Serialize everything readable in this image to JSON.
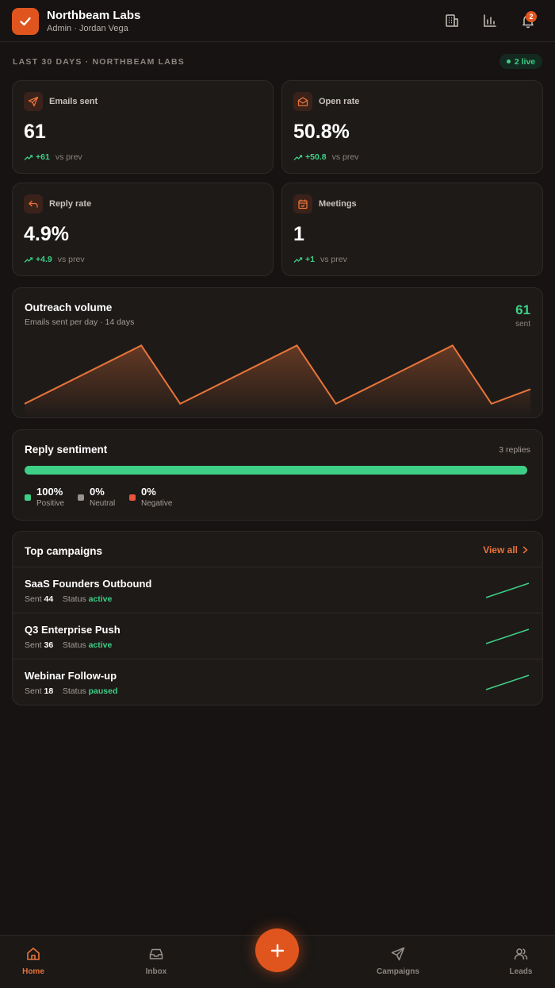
{
  "header": {
    "brand_name": "Northbeam Labs",
    "brand_sub": "Admin · Jordan Vega",
    "notification_count": "2",
    "icons": [
      "building-icon",
      "bar-chart-icon",
      "bell-icon"
    ]
  },
  "range": {
    "label": "LAST 30 DAYS · NORTHBEAM LABS",
    "live": "2 live"
  },
  "stats": [
    {
      "label": "Emails sent",
      "value": "61",
      "delta": "+61",
      "vs": "vs prev",
      "icon": "send-icon"
    },
    {
      "label": "Open rate",
      "value": "50.8%",
      "delta": "+50.8",
      "vs": "vs prev",
      "icon": "mail-open-icon"
    },
    {
      "label": "Reply rate",
      "value": "4.9%",
      "delta": "+4.9",
      "vs": "vs prev",
      "icon": "reply-icon"
    },
    {
      "label": "Meetings",
      "value": "1",
      "delta": "+1",
      "vs": "vs prev",
      "icon": "calendar-check-icon"
    }
  ],
  "volume": {
    "title": "Outreach volume",
    "subtitle": "Emails sent per day · 14 days",
    "total": "61",
    "total_unit": "sent"
  },
  "chart_data": {
    "type": "area",
    "x": [
      1,
      2,
      3,
      4,
      5,
      6,
      7,
      8,
      9,
      10,
      11,
      12,
      13,
      14
    ],
    "values": [
      1,
      3,
      5,
      7,
      1,
      3,
      5,
      7,
      1,
      3,
      5,
      7,
      1,
      2.5
    ],
    "ylim": [
      0,
      8
    ],
    "color": "#e8743a"
  },
  "sentiment": {
    "title": "Reply sentiment",
    "count": "3 replies",
    "positive_fraction": 1.0,
    "items": [
      {
        "pct": "100%",
        "name": "Positive",
        "color": "#3ecf86"
      },
      {
        "pct": "0%",
        "name": "Neutral",
        "color": "#9a928c"
      },
      {
        "pct": "0%",
        "name": "Negative",
        "color": "#e8553a"
      }
    ]
  },
  "campaigns": {
    "title": "Top campaigns",
    "view_all": "View all",
    "sent_label": "Sent",
    "status_label": "Status",
    "rows": [
      {
        "name": "SaaS Founders Outbound",
        "sent": "44",
        "status": "active"
      },
      {
        "name": "Q3 Enterprise Push",
        "sent": "36",
        "status": "active"
      },
      {
        "name": "Webinar Follow-up",
        "sent": "18",
        "status": "paused"
      }
    ]
  },
  "nav": {
    "items": [
      {
        "label": "Home",
        "icon": "home-icon",
        "active": true
      },
      {
        "label": "Inbox",
        "icon": "inbox-icon"
      },
      {
        "label": "Campaigns",
        "icon": "send-icon"
      },
      {
        "label": "Leads",
        "icon": "users-icon"
      }
    ],
    "fab_icon": "plus-icon"
  },
  "colors": {
    "accent": "#e0551e",
    "positive": "#3ecf86",
    "background": "#161312",
    "card": "#1e1a18"
  }
}
